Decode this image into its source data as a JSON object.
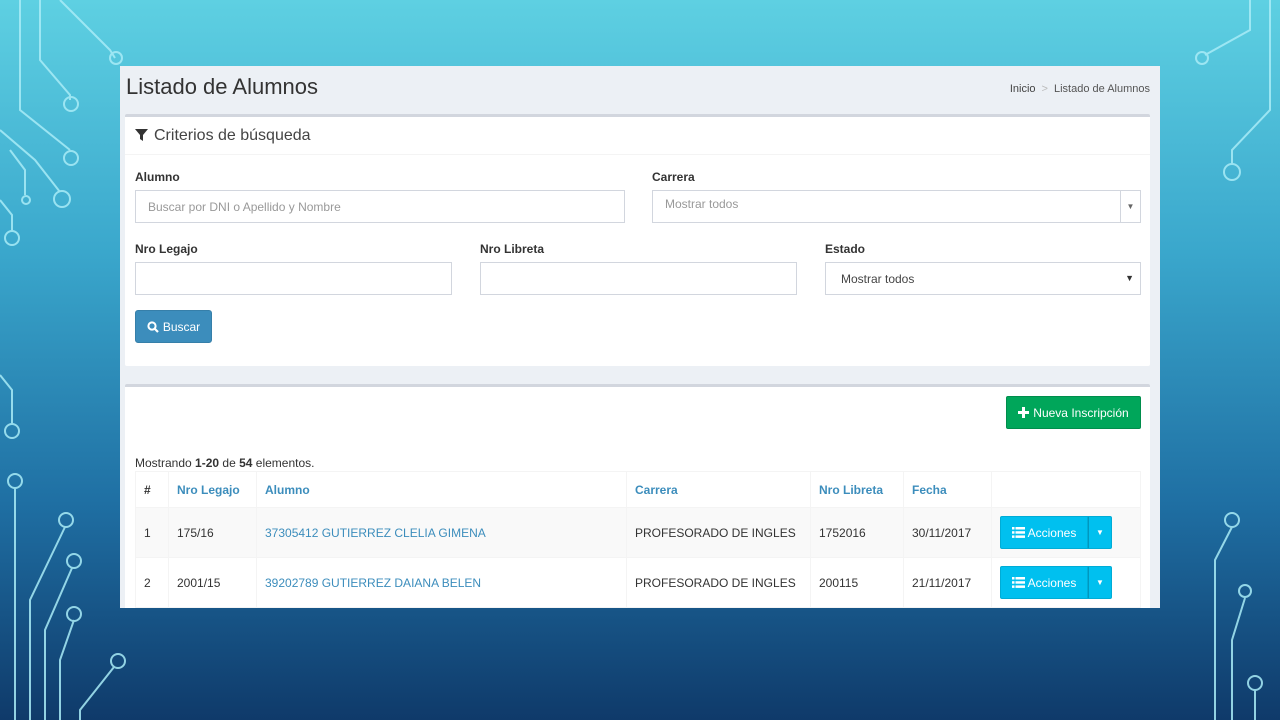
{
  "page": {
    "title": "Listado de Alumnos",
    "breadcrumb": {
      "home": "Inicio",
      "sep": ">",
      "current": "Listado de Alumnos"
    }
  },
  "search": {
    "header": "Criterios de búsqueda",
    "alumno": {
      "label": "Alumno",
      "placeholder": "Buscar por DNI o Apellido y Nombre"
    },
    "carrera": {
      "label": "Carrera",
      "value": "Mostrar todos"
    },
    "nro_legajo": {
      "label": "Nro Legajo",
      "value": ""
    },
    "nro_libreta": {
      "label": "Nro Libreta",
      "value": ""
    },
    "estado": {
      "label": "Estado",
      "value": "Mostrar todos"
    },
    "button": "Buscar"
  },
  "results": {
    "new_button": "Nueva Inscripción",
    "showing_prefix": "Mostrando ",
    "showing_range": "1-20",
    "showing_mid": " de ",
    "showing_total": "54",
    "showing_suffix": " elementos.",
    "columns": [
      "#",
      "Nro Legajo",
      "Alumno",
      "Carrera",
      "Nro Libreta",
      "Fecha",
      ""
    ],
    "rows": [
      {
        "num": "1",
        "legajo": "175/16",
        "alumno": "37305412 GUTIERREZ CLELIA GIMENA",
        "carrera": "PROFESORADO DE INGLES",
        "libreta": "1752016",
        "fecha": "30/11/2017"
      },
      {
        "num": "2",
        "legajo": "2001/15",
        "alumno": "39202789 GUTIERREZ DAIANA BELEN",
        "carrera": "PROFESORADO DE INGLES",
        "libreta": "200115",
        "fecha": "21/11/2017"
      }
    ],
    "actions_label": "Acciones"
  },
  "colors": {
    "primary": "#3c8dbc",
    "success": "#00a65a",
    "info": "#00c0ef"
  }
}
